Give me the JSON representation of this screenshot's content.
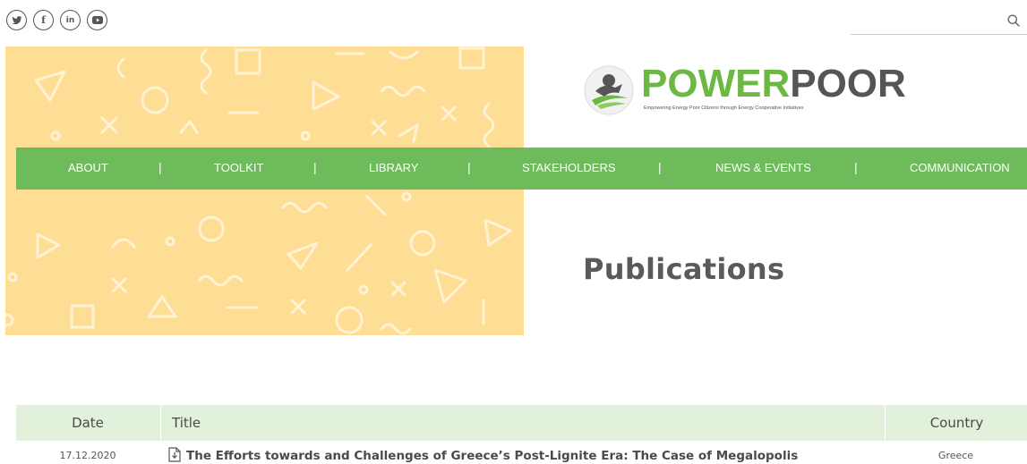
{
  "social": {
    "twitter": "twitter-icon",
    "facebook": "facebook-icon",
    "linkedin": "linkedin-icon",
    "youtube": "youtube-icon",
    "linkedin_text": "in",
    "facebook_text": "f"
  },
  "search": {
    "placeholder": ""
  },
  "logo": {
    "word_power": "POWER",
    "word_poor": "POOR",
    "tagline": "Empowering Energy Poor Citizens through Energy Cooperative Initiatives"
  },
  "nav": {
    "items": [
      {
        "label": "ABOUT"
      },
      {
        "label": "TOOLKIT"
      },
      {
        "label": "LIBRARY"
      },
      {
        "label": "STAKEHOLDERS"
      },
      {
        "label": "NEWS & EVENTS"
      },
      {
        "label": "COMMUNICATION"
      }
    ],
    "separator": "|"
  },
  "page": {
    "title": "Publications"
  },
  "table": {
    "headers": {
      "date": "Date",
      "title": "Title",
      "country": "Country"
    },
    "rows": [
      {
        "date": "17.12.2020",
        "title": "The Efforts towards and Challenges of Greece’s Post-Lignite Era: The Case of Megalopolis",
        "country": "Greece"
      }
    ]
  },
  "colors": {
    "nav_green": "#6dbb5a",
    "banner_yellow": "#fedd94",
    "header_row": "#e2f1dc",
    "logo_green": "#6bb843"
  }
}
